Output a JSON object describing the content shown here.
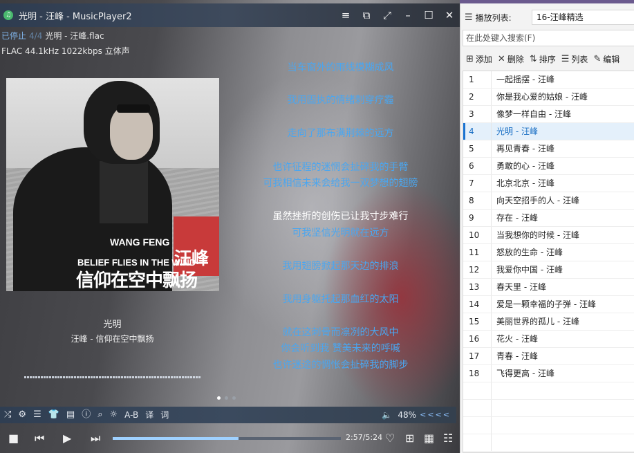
{
  "window": {
    "app_icon_glyph": "♫",
    "title": "光明 - 汪峰 - MusicPlayer2",
    "buttons": [
      "menu-icon",
      "mini-mode-icon",
      "fullscreen-icon",
      "minimize-icon",
      "maximize-icon",
      "close-icon"
    ]
  },
  "status": {
    "state": "已停止",
    "faint": "4/4",
    "filename": "光明 - 汪峰.flac",
    "format": "FLAC 44.1kHz 1022kbps 立体声"
  },
  "album_cover": {
    "artist_en": "WANG FENG",
    "artist_cn": "汪峰",
    "album_en": "BELIEF FLIES IN THE WIND",
    "album_cn": "信仰在空中飘扬"
  },
  "song": {
    "title": "光明",
    "artist_album": "汪峰 - 信仰在空中飘扬"
  },
  "lyrics": [
    "当车窗外的雨线模糊成风",
    "我用固执的情绪刺穿疗霾",
    "走向了那布满荆棘的远方",
    "也许征程的迷惘会扯碎我的手臂",
    "可我相信未来会给我一双梦想的翅膀",
    "虽然挫折的创伤已让我寸步难行",
    "可我坚信光明就在远方",
    "我用翅膀掀起那天边的排浪",
    "我用身躯托起那血红的太阳",
    "就在这刺骨而凛冽的大风中",
    "你会听到我 赞美未来的呼喊",
    "也许迷途的惆怅会扯碎我的脚步"
  ],
  "current_lyric_index": 5,
  "toolbar": {
    "ab_label": "A-B",
    "translate_label": "译",
    "lyrics_label": "词",
    "volume": "48%",
    "arrows": "<<<<"
  },
  "playback": {
    "time": "2:57/5:24",
    "progress": 0.55
  },
  "playlist": {
    "label": "播放列表:",
    "name": "16-汪峰精选",
    "search_placeholder": "在此处键入搜索(F)",
    "actions": {
      "add": "添加",
      "delete": "删除",
      "sort": "排序",
      "list": "列表",
      "edit": "编辑"
    },
    "playing_index": 3,
    "items": [
      {
        "num": "1",
        "title": "一起摇摆 - 汪峰"
      },
      {
        "num": "2",
        "title": "你是我心爱的姑娘 - 汪峰"
      },
      {
        "num": "3",
        "title": "像梦一样自由 - 汪峰"
      },
      {
        "num": "4",
        "title": "光明 - 汪峰"
      },
      {
        "num": "5",
        "title": "再见青春 - 汪峰"
      },
      {
        "num": "6",
        "title": "勇敢的心 - 汪峰"
      },
      {
        "num": "7",
        "title": "北京北京 - 汪峰"
      },
      {
        "num": "8",
        "title": "向天空招手的人 - 汪峰"
      },
      {
        "num": "9",
        "title": "存在 - 汪峰"
      },
      {
        "num": "10",
        "title": "当我想你的时候 - 汪峰"
      },
      {
        "num": "11",
        "title": "怒放的生命 - 汪峰"
      },
      {
        "num": "12",
        "title": "我爱你中国 - 汪峰"
      },
      {
        "num": "13",
        "title": "春天里 - 汪峰"
      },
      {
        "num": "14",
        "title": "爱是一颗幸福的子弹 - 汪峰"
      },
      {
        "num": "15",
        "title": "美丽世界的孤儿 - 汪峰"
      },
      {
        "num": "16",
        "title": "花火 - 汪峰"
      },
      {
        "num": "17",
        "title": "青春 - 汪峰"
      },
      {
        "num": "18",
        "title": "飞得更高 - 汪峰"
      }
    ]
  }
}
